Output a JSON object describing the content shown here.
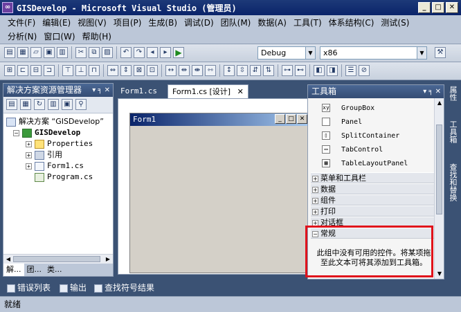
{
  "window": {
    "title": "GISDevelop - Microsoft Visual Studio (管理员)",
    "app_icon": "vs-logo-icon"
  },
  "menu": {
    "row1": [
      "文件(F)",
      "编辑(E)",
      "视图(V)",
      "项目(P)",
      "生成(B)",
      "调试(D)",
      "团队(M)",
      "数据(A)",
      "工具(T)",
      "体系结构(C)",
      "测试(S)"
    ],
    "row2": [
      "分析(N)",
      "窗口(W)",
      "帮助(H)"
    ]
  },
  "toolbar": {
    "config": "Debug",
    "platform": "x86"
  },
  "solution_explorer": {
    "title": "解决方案资源管理器",
    "pin": "▾ ╕ ✕",
    "solution": "解决方案 “GISDevelop”",
    "project": "GISDevelop",
    "items": [
      "Properties",
      "引用",
      "Form1.cs",
      "Program.cs"
    ],
    "tabs": [
      "解...",
      "团...",
      "类..."
    ]
  },
  "doc_tabs": {
    "tab1": "Form1.cs",
    "tab2": "Form1.cs [设计]",
    "close": "✕"
  },
  "designer": {
    "form_title": "Form1"
  },
  "toolbox": {
    "title": "工具箱",
    "header_buttons": "▾ ╕ ✕",
    "items": [
      "GroupBox",
      "Panel",
      "SplitContainer",
      "TabControl",
      "TableLayoutPanel"
    ],
    "categories": [
      "菜单和工具栏",
      "数据",
      "组件",
      "打印",
      "对话框",
      "常规"
    ],
    "empty_message": "此组中没有可用的控件。将某项拖至此文本可将其添加到工具箱。",
    "highlight_color": "#e0121b"
  },
  "right_rail": {
    "tabs": [
      "属性",
      "工具箱",
      "查找和替换"
    ]
  },
  "bottom_tabs": [
    "错误列表",
    "输出",
    "查找符号结果"
  ],
  "status": "就绪"
}
